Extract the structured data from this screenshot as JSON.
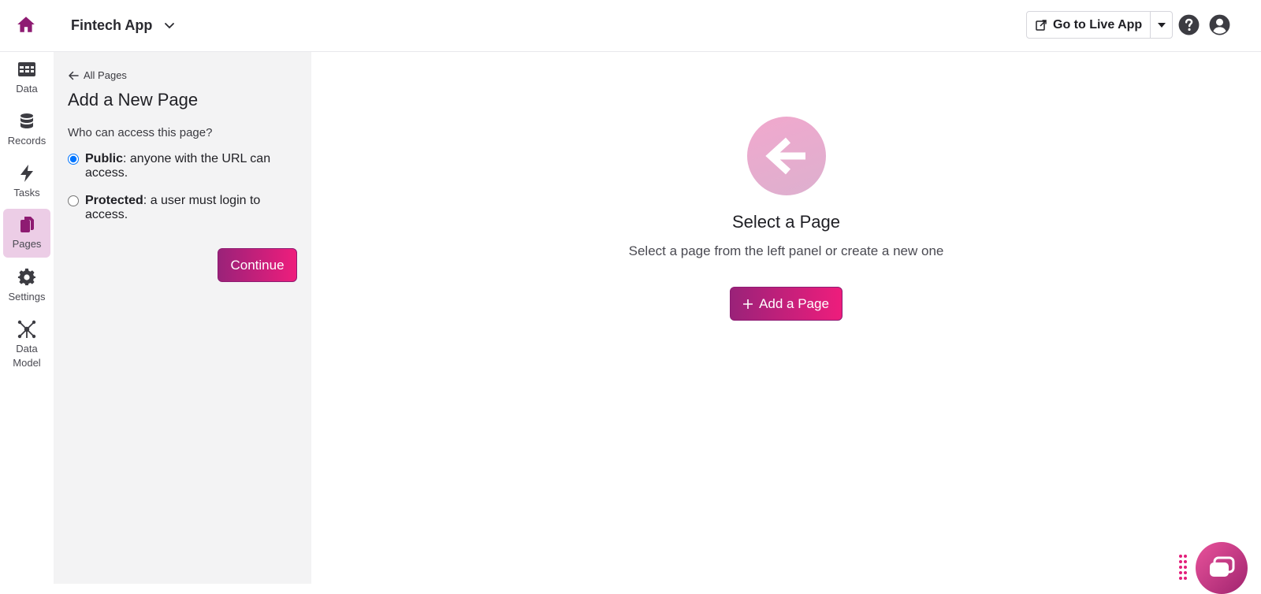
{
  "topbar": {
    "app_name": "Fintech App",
    "live_button_label": "Go to Live App"
  },
  "nav": {
    "items": [
      {
        "label": "Data",
        "icon": "table-icon"
      },
      {
        "label": "Records",
        "icon": "database-icon"
      },
      {
        "label": "Tasks",
        "icon": "bolt-icon"
      },
      {
        "label": "Pages",
        "icon": "pages-icon",
        "active": true
      },
      {
        "label": "Settings",
        "icon": "gear-icon"
      },
      {
        "label": "Data Model",
        "icon": "network-icon"
      }
    ]
  },
  "panel": {
    "back_label": "All Pages",
    "title": "Add a New Page",
    "question": "Who can access this page?",
    "options": [
      {
        "name": "Public",
        "desc": ": anyone with the URL can access.",
        "checked": true
      },
      {
        "name": "Protected",
        "desc": ": a user must login to access.",
        "checked": false
      }
    ],
    "continue_label": "Continue"
  },
  "main": {
    "title": "Select a Page",
    "subtitle": "Select a page from the left panel or create a new one",
    "add_button_label": "Add a Page"
  },
  "colors": {
    "brand": "#8e1b72",
    "accent": "#ee1d7c",
    "active_nav": "#eccde6"
  }
}
